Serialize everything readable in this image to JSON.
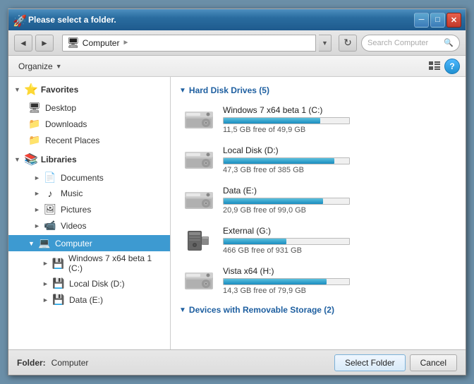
{
  "window": {
    "title": "Please select a folder.",
    "icon": "🚀"
  },
  "toolbar": {
    "back_label": "◄",
    "forward_label": "►",
    "address_parts": [
      "Computer"
    ],
    "refresh_label": "↻",
    "search_placeholder": "Search Computer",
    "address_dropdown": "▼",
    "address_separator": "►"
  },
  "organize_bar": {
    "organize_label": "Organize",
    "chevron": "▼",
    "view_icon": "≡",
    "help_label": "?"
  },
  "sidebar": {
    "favorites": {
      "label": "Favorites",
      "icon": "⭐",
      "items": [
        {
          "label": "Desktop",
          "icon": "🖥"
        },
        {
          "label": "Downloads",
          "icon": "📁"
        },
        {
          "label": "Recent Places",
          "icon": "📁"
        }
      ]
    },
    "libraries": {
      "label": "Libraries",
      "icon": "📚",
      "items": [
        {
          "label": "Documents",
          "icon": "📄"
        },
        {
          "label": "Music",
          "icon": "♪"
        },
        {
          "label": "Pictures",
          "icon": "🖼"
        },
        {
          "label": "Videos",
          "icon": "📹"
        }
      ]
    },
    "computer": {
      "label": "Computer",
      "icon": "💻",
      "selected": true,
      "children": [
        {
          "label": "Windows 7 x64 beta 1 (C:)",
          "icon": "💾"
        },
        {
          "label": "Local Disk (D:)",
          "icon": "💾"
        },
        {
          "label": "Data (E:)",
          "icon": "💾"
        }
      ]
    }
  },
  "main": {
    "hard_disk_section": {
      "header": "Hard Disk Drives (5)",
      "drives": [
        {
          "name": "Windows 7 x64 beta 1 (C:)",
          "free": "11,5 GB free of 49,9 GB",
          "used_pct": 77,
          "bar_color": "used"
        },
        {
          "name": "Local Disk (D:)",
          "free": "47,3 GB free of 385 GB",
          "used_pct": 88,
          "bar_color": "used"
        },
        {
          "name": "Data (E:)",
          "free": "20,9 GB free of 99,0 GB",
          "used_pct": 79,
          "bar_color": "used"
        },
        {
          "name": "External (G:)",
          "free": "466 GB free of 931 GB",
          "used_pct": 50,
          "bar_color": "used"
        },
        {
          "name": "Vista x64 (H:)",
          "free": "14,3 GB free of 79,9 GB",
          "used_pct": 82,
          "bar_color": "used"
        }
      ]
    },
    "removable_section": {
      "header": "Devices with Removable Storage (2)"
    }
  },
  "bottom": {
    "folder_label": "Folder:",
    "folder_value": "Computer",
    "select_label": "Select Folder",
    "cancel_label": "Cancel"
  }
}
